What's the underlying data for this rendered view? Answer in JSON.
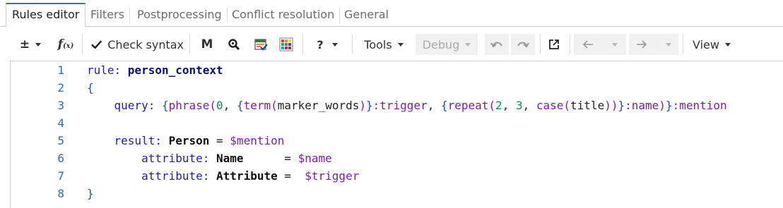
{
  "tabs": [
    {
      "label": "Rules editor",
      "active": true
    },
    {
      "label": "Filters",
      "active": false
    },
    {
      "label": "Postprocessing",
      "active": false
    },
    {
      "label": "Conflict resolution",
      "active": false
    },
    {
      "label": "General",
      "active": false
    }
  ],
  "toolbar": {
    "plus_minus": "±",
    "fx_label": "f",
    "fx_sub": "(x)",
    "check_syntax": "Check syntax",
    "m_label": "M",
    "help": "?",
    "tools": "Tools",
    "debug": "Debug",
    "view": "View"
  },
  "editor": {
    "lines": [
      {
        "num": "1",
        "tokens": [
          {
            "t": "rule: ",
            "c": "kw"
          },
          {
            "t": "person_context",
            "c": "id"
          }
        ]
      },
      {
        "num": "2",
        "tokens": [
          {
            "t": "{",
            "c": "brace"
          }
        ]
      },
      {
        "num": "3",
        "tokens": [
          {
            "t": "    query: ",
            "c": "kw"
          },
          {
            "t": "{",
            "c": "brace"
          },
          {
            "t": "phrase(",
            "c": "fn"
          },
          {
            "t": "0",
            "c": "num"
          },
          {
            "t": ", ",
            "c": "plain"
          },
          {
            "t": "{",
            "c": "brace"
          },
          {
            "t": "term(",
            "c": "fn"
          },
          {
            "t": "marker_words",
            "c": "plain"
          },
          {
            "t": ")",
            "c": "fn"
          },
          {
            "t": "}",
            "c": "brace"
          },
          {
            "t": ":trigger",
            "c": "var"
          },
          {
            "t": ", ",
            "c": "plain"
          },
          {
            "t": "{",
            "c": "brace"
          },
          {
            "t": "repeat(",
            "c": "fn"
          },
          {
            "t": "2",
            "c": "num"
          },
          {
            "t": ", ",
            "c": "plain"
          },
          {
            "t": "3",
            "c": "num"
          },
          {
            "t": ", ",
            "c": "plain"
          },
          {
            "t": "case(",
            "c": "fn"
          },
          {
            "t": "title",
            "c": "plain"
          },
          {
            "t": "))",
            "c": "fn"
          },
          {
            "t": "}",
            "c": "brace"
          },
          {
            "t": ":name",
            "c": "var"
          },
          {
            "t": ")",
            "c": "fn"
          },
          {
            "t": "}",
            "c": "brace"
          },
          {
            "t": ":mention",
            "c": "var"
          }
        ]
      },
      {
        "num": "4",
        "tokens": []
      },
      {
        "num": "5",
        "tokens": [
          {
            "t": "    result: ",
            "c": "kw"
          },
          {
            "t": "Person",
            "c": "bold"
          },
          {
            "t": " = ",
            "c": "plain"
          },
          {
            "t": "$mention",
            "c": "var"
          }
        ]
      },
      {
        "num": "6",
        "tokens": [
          {
            "t": "        attribute: ",
            "c": "kw"
          },
          {
            "t": "Name",
            "c": "bold"
          },
          {
            "t": "      = ",
            "c": "plain"
          },
          {
            "t": "$name",
            "c": "var"
          }
        ]
      },
      {
        "num": "7",
        "tokens": [
          {
            "t": "        attribute: ",
            "c": "kw"
          },
          {
            "t": "Attribute",
            "c": "bold"
          },
          {
            "t": " =  ",
            "c": "plain"
          },
          {
            "t": "$trigger",
            "c": "var"
          }
        ]
      },
      {
        "num": "8",
        "tokens": [
          {
            "t": "}",
            "c": "brace"
          }
        ]
      }
    ]
  },
  "colors": {
    "accent": "#2f76b6",
    "line_number": "#2b6cb0",
    "keyword": "#1f1f9b",
    "function": "#7a1fa2",
    "number": "#0c8a5a"
  },
  "icons": [
    "plus-minus-icon",
    "function-icon",
    "check-icon",
    "magnify-icon",
    "calendar-check-icon",
    "color-grid-icon",
    "undo-icon",
    "redo-icon",
    "open-external-icon",
    "arrow-left-icon",
    "arrow-right-icon"
  ]
}
